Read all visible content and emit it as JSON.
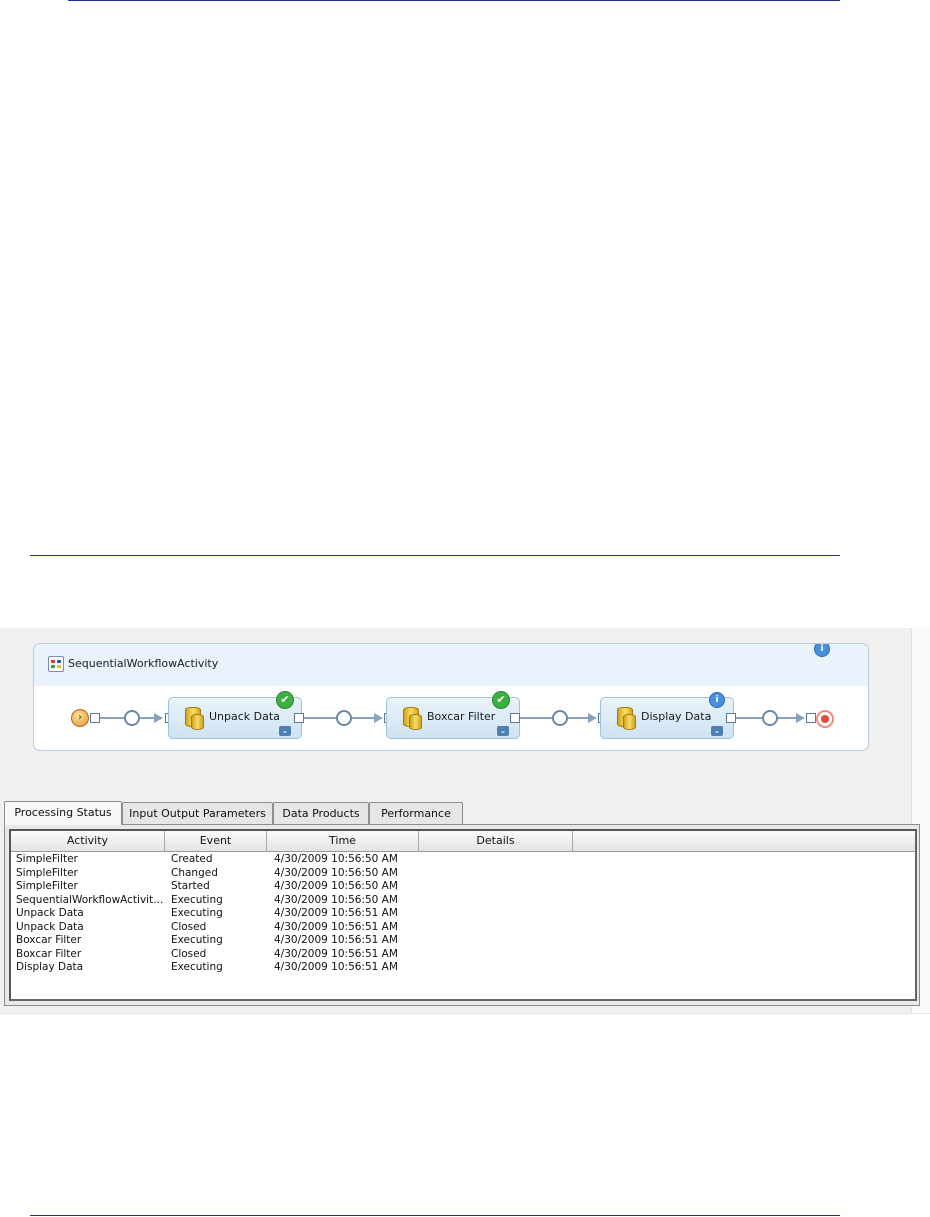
{
  "workflow": {
    "title": "SequentialWorkflowActivity",
    "activities": [
      {
        "label": "Unpack Data",
        "status": "completed"
      },
      {
        "label": "Boxcar Filter",
        "status": "completed"
      },
      {
        "label": "Display Data",
        "status": "info"
      }
    ],
    "icons": {
      "title": "workflow-icon",
      "start": "start-icon",
      "end": "end-icon",
      "activity": "database-icon",
      "completed": "check-icon",
      "info": "info-icon",
      "expand": "chevron-down-icon"
    },
    "glyphs": {
      "check": "✔",
      "info": "i",
      "chevron": "⌄",
      "start": "›"
    }
  },
  "tabs": [
    "Processing Status",
    "Input Output Parameters",
    "Data Products",
    "Performance"
  ],
  "table": {
    "columns": [
      "Activity",
      "Event",
      "Time",
      "Details"
    ],
    "rows": [
      {
        "activity": "SimpleFilter",
        "event": "Created",
        "time": "4/30/2009 10:56:50 AM",
        "details": ""
      },
      {
        "activity": "SimpleFilter",
        "event": "Changed",
        "time": "4/30/2009 10:56:50 AM",
        "details": ""
      },
      {
        "activity": "SimpleFilter",
        "event": "Started",
        "time": "4/30/2009 10:56:50 AM",
        "details": ""
      },
      {
        "activity": "SequentialWorkflowActivit...",
        "event": "Executing",
        "time": "4/30/2009 10:56:50 AM",
        "details": ""
      },
      {
        "activity": "Unpack Data",
        "event": "Executing",
        "time": "4/30/2009 10:56:51 AM",
        "details": ""
      },
      {
        "activity": "Unpack Data",
        "event": "Closed",
        "time": "4/30/2009 10:56:51 AM",
        "details": ""
      },
      {
        "activity": "Boxcar Filter",
        "event": "Executing",
        "time": "4/30/2009 10:56:51 AM",
        "details": ""
      },
      {
        "activity": "Boxcar Filter",
        "event": "Closed",
        "time": "4/30/2009 10:56:51 AM",
        "details": ""
      },
      {
        "activity": "Display Data",
        "event": "Executing",
        "time": "4/30/2009 10:56:51 AM",
        "details": ""
      }
    ]
  },
  "colors": {
    "rule": "#1f2f8f",
    "check": "#3cb043",
    "info": "#4a8fdc",
    "wire": "#8aa3bd"
  }
}
